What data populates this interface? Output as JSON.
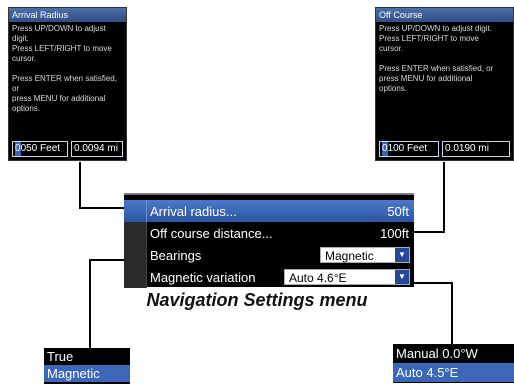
{
  "arrival_dialog": {
    "title": "Arrival Radius",
    "body": "Press UP/DOWN to adjust digit.\nPress LEFT/RIGHT to move\ncursor.\n\nPress ENTER when satisfied, or\npress MENU for additional\noptions.",
    "cursor_digit": "0",
    "value_feet_rest": "050 Feet",
    "value_miles": "0.0094 mi"
  },
  "offcourse_dialog": {
    "title": "Off Course",
    "body": "Press UP/DOWN to adjust digit.\nPress LEFT/RIGHT to move\ncursor.\n\nPress ENTER when satisfied, or\npress MENU for additional\noptions.",
    "cursor_digit": "0",
    "value_feet_rest": "100 Feet",
    "value_miles": "0.0190 mi"
  },
  "menu": {
    "items": [
      {
        "label": "Arrival radius...",
        "value": "50ft",
        "selected": true
      },
      {
        "label": "Off course distance...",
        "value": "100ft"
      },
      {
        "label": "Bearings",
        "value": "Magnetic"
      },
      {
        "label": "Magnetic variation",
        "value": "Auto 4.6°E"
      }
    ]
  },
  "caption": "Navigation Settings menu",
  "bearings_options": [
    "True",
    "Magnetic"
  ],
  "variation_options": [
    "Manual 0.0°W",
    "Auto 4.5°E"
  ],
  "colors": {
    "accent": "#3b67b8",
    "panel": "#000000"
  }
}
